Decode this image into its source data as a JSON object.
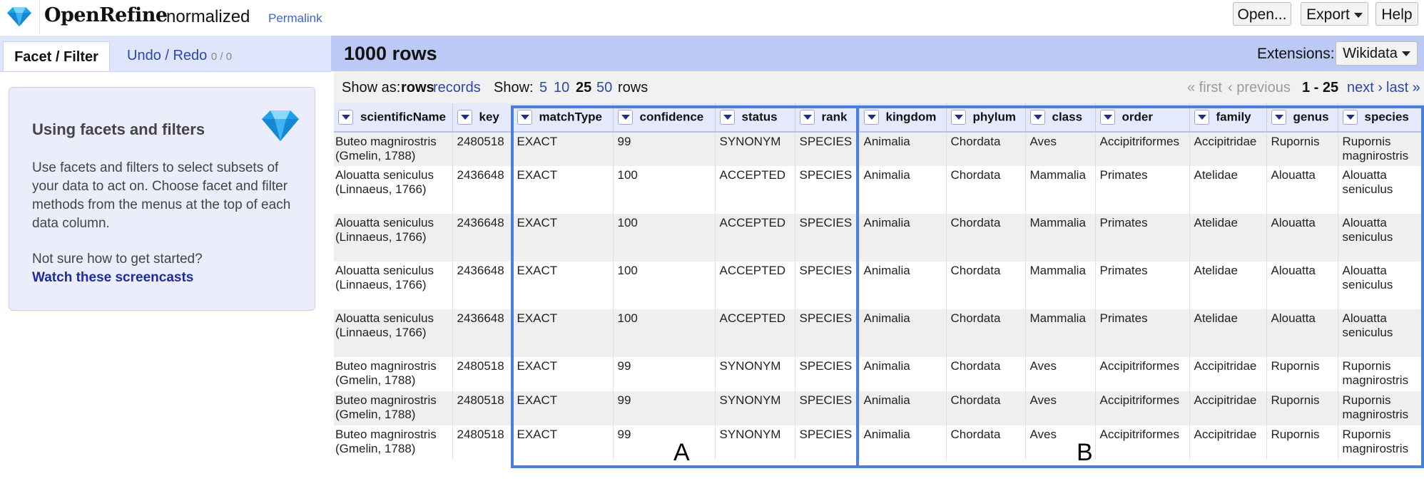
{
  "header": {
    "brand": "OpenRefine",
    "project_name": "normalized",
    "permalink": "Permalink",
    "buttons": {
      "open": "Open...",
      "export": "Export",
      "help": "Help"
    }
  },
  "left_panel": {
    "tabs": {
      "facet": "Facet / Filter",
      "undo": "Undo / Redo",
      "undo_count": "0 / 0"
    },
    "help": {
      "title": "Using facets and filters",
      "body": "Use facets and filters to select subsets of your data to act on. Choose facet and filter methods from the menus at the top of each data column.",
      "question": "Not sure how to get started?",
      "link": "Watch these screencasts"
    }
  },
  "main": {
    "row_count": "1000 rows",
    "extensions_label": "Extensions:",
    "extensions_button": "Wikidata",
    "show_as": {
      "label": "Show as:",
      "rows": "rows",
      "records": "records"
    },
    "show": {
      "label": "Show:",
      "options": [
        "5",
        "10",
        "25",
        "50"
      ],
      "selected": "25",
      "suffix": "rows"
    },
    "pager": {
      "first": "« first",
      "previous": "‹ previous",
      "range": "1 - 25",
      "next": "next ›",
      "last": "last »"
    }
  },
  "table": {
    "columns": [
      "scientificName",
      "key",
      "matchType",
      "confidence",
      "status",
      "rank",
      "kingdom",
      "phylum",
      "class",
      "order",
      "family",
      "genus",
      "species"
    ],
    "rows": [
      [
        "Buteo magnirostris\n(Gmelin, 1788)",
        "2480518",
        "EXACT",
        "99",
        "SYNONYM",
        "SPECIES",
        "Animalia",
        "Chordata",
        "Aves",
        "Accipitriformes",
        "Accipitridae",
        "Rupornis",
        "Rupornis\nmagnirostris"
      ],
      [
        "Alouatta seniculus\n(Linnaeus, 1766)",
        "2436648",
        "EXACT",
        "100",
        "ACCEPTED",
        "SPECIES",
        "Animalia",
        "Chordata",
        "Mammalia",
        "Primates",
        "Atelidae",
        "Alouatta",
        "Alouatta\nseniculus"
      ],
      [
        "Alouatta seniculus\n(Linnaeus, 1766)",
        "2436648",
        "EXACT",
        "100",
        "ACCEPTED",
        "SPECIES",
        "Animalia",
        "Chordata",
        "Mammalia",
        "Primates",
        "Atelidae",
        "Alouatta",
        "Alouatta\nseniculus"
      ],
      [
        "Alouatta seniculus\n(Linnaeus, 1766)",
        "2436648",
        "EXACT",
        "100",
        "ACCEPTED",
        "SPECIES",
        "Animalia",
        "Chordata",
        "Mammalia",
        "Primates",
        "Atelidae",
        "Alouatta",
        "Alouatta\nseniculus"
      ],
      [
        "Alouatta seniculus\n(Linnaeus, 1766)",
        "2436648",
        "EXACT",
        "100",
        "ACCEPTED",
        "SPECIES",
        "Animalia",
        "Chordata",
        "Mammalia",
        "Primates",
        "Atelidae",
        "Alouatta",
        "Alouatta\nseniculus"
      ],
      [
        "Buteo magnirostris\n(Gmelin, 1788)",
        "2480518",
        "EXACT",
        "99",
        "SYNONYM",
        "SPECIES",
        "Animalia",
        "Chordata",
        "Aves",
        "Accipitriformes",
        "Accipitridae",
        "Rupornis",
        "Rupornis\nmagnirostris"
      ],
      [
        "Buteo magnirostris\n(Gmelin, 1788)",
        "2480518",
        "EXACT",
        "99",
        "SYNONYM",
        "SPECIES",
        "Animalia",
        "Chordata",
        "Aves",
        "Accipitriformes",
        "Accipitridae",
        "Rupornis",
        "Rupornis\nmagnirostris"
      ],
      [
        "Buteo magnirostris\n(Gmelin, 1788)",
        "2480518",
        "EXACT",
        "99",
        "SYNONYM",
        "SPECIES",
        "Animalia",
        "Chordata",
        "Aves",
        "Accipitriformes",
        "Accipitridae",
        "Rupornis",
        "Rupornis\nmagnirostris"
      ]
    ]
  },
  "annotations": {
    "box_a": "A",
    "box_b": "B"
  },
  "colors": {
    "accent": "#4a7fdc",
    "header_band": "#bcc9f5",
    "tab_strip": "#dfe5fa",
    "link": "#2a46b0"
  }
}
